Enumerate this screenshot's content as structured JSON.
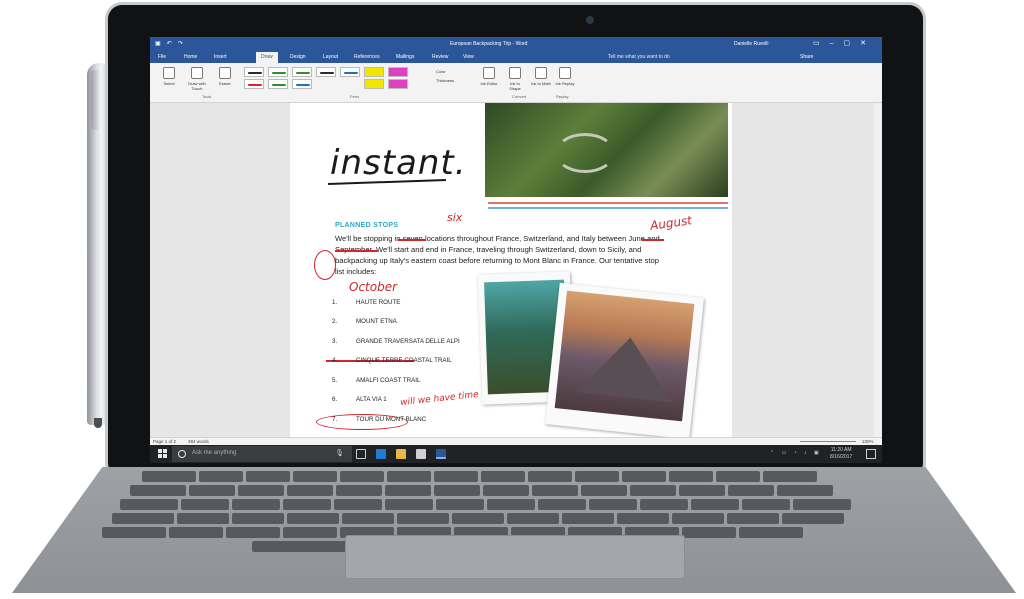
{
  "word": {
    "doc_title": "European Backpacking Trip - Word",
    "user": "Danielle Ruvelli",
    "tabs": [
      "File",
      "Home",
      "Insert",
      "Draw",
      "Design",
      "Layout",
      "References",
      "Mailings",
      "Review",
      "View"
    ],
    "active_tab": "Draw",
    "tell_me": "Tell me what you want to do",
    "share": "Share",
    "ribbon": {
      "select": "Select",
      "draw_with_touch": "Draw with Touch",
      "eraser": "Eraser",
      "tools_label": "Tools",
      "pens_label": "Pens",
      "color": "Color",
      "thickness": "Thickness",
      "ink_to_shape": "Ink to Shape",
      "ink_to_math": "Ink to Math",
      "convert_label": "Convert",
      "ink_replay": "Ink Replay",
      "replay_label": "Replay",
      "ink_editor": "Ink Editor"
    },
    "pen_colors": [
      "#2b2b2b",
      "#2f8f2f",
      "#2f8f2f",
      "#2b2b2b",
      "#1f6fc1",
      "#d3262c",
      "#2f8f2f",
      "#1f6fc1",
      "#f2e600",
      "#e040c0"
    ]
  },
  "document": {
    "big_word": "instant.",
    "heading": "PLANNED STOPS",
    "paragraph": "We'll be stopping in seven locations throughout France, Switzerland, and Italy between June and September. We'll start and end in France, traveling through Switzerland, down to Sicily, and backpacking up Italy's eastern coast before returning to Mont Blanc in France. Our tentative stop list includes:",
    "ink": {
      "six": "six",
      "august": "August",
      "october": "October",
      "question": "will we have time for this?"
    },
    "stops": [
      {
        "num": "1.",
        "name": "HAUTE ROUTE"
      },
      {
        "num": "2.",
        "name": "MOUNT ETNA"
      },
      {
        "num": "3.",
        "name": "GRANDE TRAVERSATA DELLE ALPI"
      },
      {
        "num": "4.",
        "name": "CINQUE TERRE COASTAL TRAIL"
      },
      {
        "num": "5.",
        "name": "AMALFI COAST TRAIL"
      },
      {
        "num": "6.",
        "name": "ALTA VIA 1"
      },
      {
        "num": "7.",
        "name": "TOUR DU MONT BLANC"
      }
    ]
  },
  "status": {
    "page": "Page 1 of 2",
    "words": "384 words",
    "zoom": "100%"
  },
  "taskbar": {
    "search_placeholder": "Ask me anything",
    "time": "11:20 AM",
    "date": "8/16/2017"
  }
}
